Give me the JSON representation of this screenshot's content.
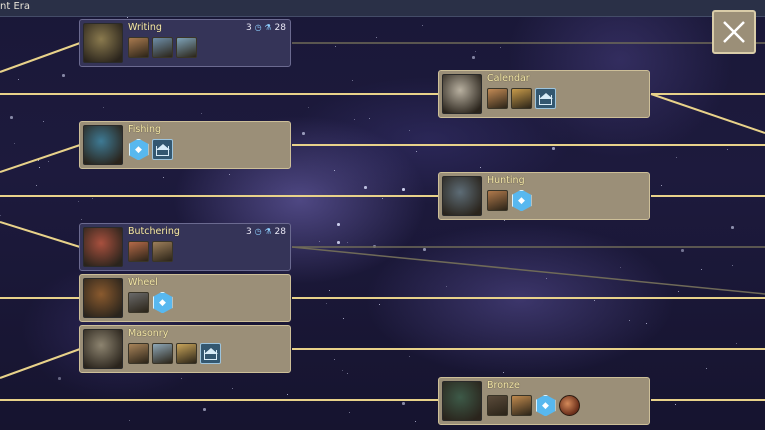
{
  "header": {
    "era_label": "nt Era"
  },
  "close_button": {
    "symbol": "✕"
  },
  "technologies": [
    {
      "name": "Writing",
      "cost_a": "3",
      "cost_b": "28",
      "portrait_color": "#8a7a4e",
      "unlocks": [
        {
          "kind": "image",
          "color": "#a87a4f"
        },
        {
          "kind": "image",
          "color": "#6e8ea8"
        },
        {
          "kind": "image",
          "color": "#7ea2b8"
        }
      ]
    },
    {
      "name": "Calendar",
      "portrait_color": "#b8b0a0",
      "unlocks": [
        {
          "kind": "image",
          "color": "#c28a55"
        },
        {
          "kind": "image",
          "color": "#c79a4a"
        },
        {
          "kind": "building"
        }
      ]
    },
    {
      "name": "Fishing",
      "portrait_color": "#3e7a94",
      "unlocks": [
        {
          "kind": "hex",
          "glyph": "◆"
        },
        {
          "kind": "building"
        }
      ]
    },
    {
      "name": "Hunting",
      "portrait_color": "#5d6c76",
      "unlocks": [
        {
          "kind": "image",
          "color": "#b07a4c"
        },
        {
          "kind": "hex",
          "glyph": "◆"
        }
      ]
    },
    {
      "name": "Butchering",
      "cost_a": "3",
      "cost_b": "28",
      "portrait_color": "#a8503e",
      "unlocks": [
        {
          "kind": "image",
          "color": "#b56a48"
        },
        {
          "kind": "image",
          "color": "#9c7e5a"
        }
      ]
    },
    {
      "name": "Wheel",
      "portrait_color": "#8a5a2e",
      "unlocks": [
        {
          "kind": "image",
          "color": "#6a6a6a"
        },
        {
          "kind": "hex",
          "glyph": "◆"
        }
      ]
    },
    {
      "name": "Masonry",
      "portrait_color": "#8d8470",
      "unlocks": [
        {
          "kind": "image",
          "color": "#a8845a"
        },
        {
          "kind": "image",
          "color": "#8fa8b8"
        },
        {
          "kind": "image",
          "color": "#c8a45a"
        },
        {
          "kind": "building"
        }
      ]
    },
    {
      "name": "Bronze",
      "portrait_color": "#3d5a48",
      "unlocks": [
        {
          "kind": "image",
          "color": "#5a4a3a"
        },
        {
          "kind": "image",
          "color": "#c08a4e"
        },
        {
          "kind": "hex",
          "glyph": "◆"
        },
        {
          "kind": "round"
        }
      ]
    }
  ]
}
